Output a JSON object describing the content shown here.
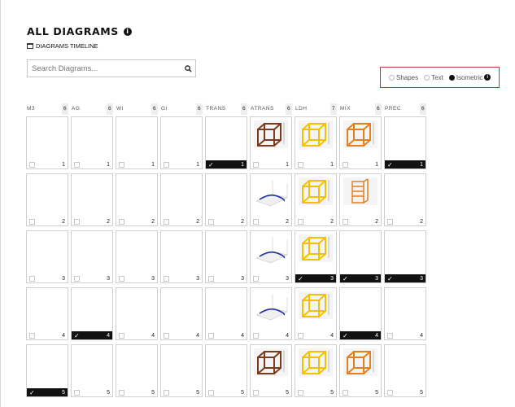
{
  "header": {
    "title": "ALL DIAGRAMS",
    "timeline_label": "DIAGRAMS TIMELINE"
  },
  "search": {
    "placeholder": "Search Diagrams..."
  },
  "view_options": {
    "items": [
      {
        "label": "Shapes",
        "selected": false
      },
      {
        "label": "Text",
        "selected": false
      },
      {
        "label": "Isometric",
        "selected": true
      }
    ]
  },
  "grid": {
    "columns": [
      {
        "label": "M3",
        "count": "6"
      },
      {
        "label": "AG",
        "count": "6"
      },
      {
        "label": "WI",
        "count": "6"
      },
      {
        "label": "GI",
        "count": "6"
      },
      {
        "label": "TRANS",
        "count": "6"
      },
      {
        "label": "ATRANS",
        "count": "6"
      },
      {
        "label": "LDH",
        "count": "7"
      },
      {
        "label": "MIX",
        "count": "6"
      },
      {
        "label": "PREC",
        "count": "6"
      }
    ],
    "rows": [
      {
        "number": "1",
        "done": [
          false,
          false,
          false,
          false,
          true,
          false,
          false,
          false,
          true
        ],
        "thumbs": [
          "",
          "",
          "",
          "",
          "",
          "cube-brown",
          "cube-yellow",
          "cube-orange",
          ""
        ]
      },
      {
        "number": "2",
        "done": [
          false,
          false,
          false,
          false,
          false,
          false,
          false,
          false,
          false
        ],
        "thumbs": [
          "",
          "",
          "",
          "",
          "",
          "plot-blue",
          "cube-yellow",
          "stack-orange",
          ""
        ]
      },
      {
        "number": "3",
        "done": [
          false,
          false,
          false,
          false,
          false,
          false,
          true,
          true,
          true
        ],
        "thumbs": [
          "",
          "",
          "",
          "",
          "",
          "plot-blue",
          "cube-yellow",
          "",
          ""
        ]
      },
      {
        "number": "4",
        "done": [
          false,
          true,
          false,
          false,
          false,
          false,
          false,
          true,
          false
        ],
        "thumbs": [
          "",
          "",
          "",
          "",
          "",
          "plot-blue",
          "cube-yellow",
          "",
          ""
        ]
      },
      {
        "number": "5",
        "done": [
          true,
          false,
          false,
          false,
          false,
          false,
          false,
          false,
          false
        ],
        "thumbs": [
          "",
          "",
          "",
          "",
          "",
          "cube-brown",
          "cube-yellow",
          "cube-orange",
          ""
        ]
      }
    ]
  },
  "colors": {
    "accent_border": "#d32f2f",
    "done_bg": "#111111",
    "cube_brown": "#7a3b1a",
    "cube_yellow": "#f2c200",
    "cube_orange": "#e08020",
    "plot_blue": "#1f2fa8"
  }
}
